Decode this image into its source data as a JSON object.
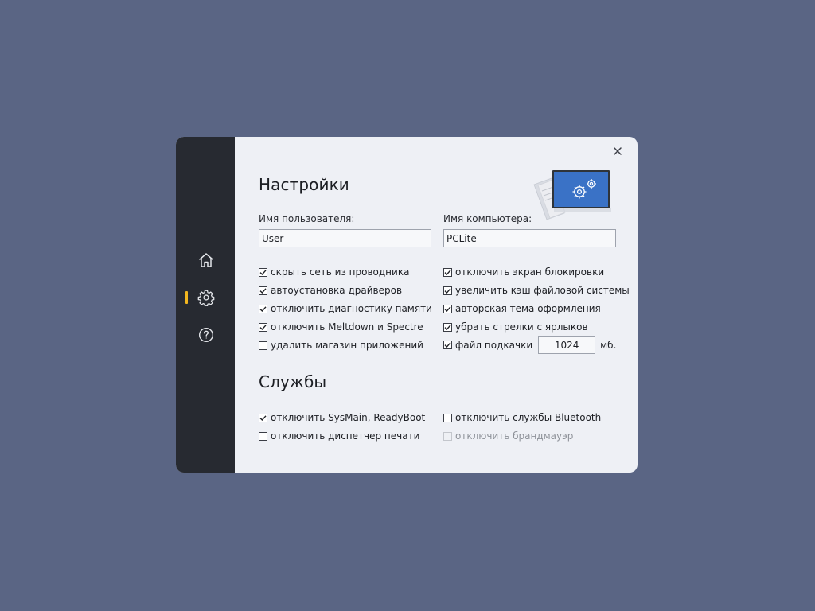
{
  "sidebar": {
    "items": [
      {
        "name": "home",
        "icon": "home-icon"
      },
      {
        "name": "settings",
        "icon": "gear-icon",
        "active": true
      },
      {
        "name": "help",
        "icon": "question-icon"
      }
    ],
    "active_color": "#f2b61f"
  },
  "window": {
    "close_icon": "close-icon"
  },
  "settings": {
    "title": "Настройки",
    "username_label": "Имя пользователя:",
    "username_value": "User",
    "computer_label": "Имя компьютера:",
    "computer_value": "PCLite",
    "options": [
      {
        "label": "скрыть сеть из проводника",
        "checked": true
      },
      {
        "label": "отключить экран блокировки",
        "checked": true
      },
      {
        "label": "автоустановка драйверов",
        "checked": true
      },
      {
        "label": "увеличить кэш файловой системы",
        "checked": true
      },
      {
        "label": "отключить диагностику памяти",
        "checked": true
      },
      {
        "label": "авторская тема оформления",
        "checked": true
      },
      {
        "label": "отключить Meltdown и Spectre",
        "checked": true
      },
      {
        "label": "убрать стрелки с ярлыков",
        "checked": true
      },
      {
        "label": "удалить магазин приложений",
        "checked": false
      },
      {
        "label": "файл подкачки",
        "checked": true
      }
    ],
    "swap_value": "1024",
    "swap_unit": "мб."
  },
  "services": {
    "title": "Службы",
    "options": [
      {
        "label": "отключить SysMain, ReadyBoot",
        "checked": true
      },
      {
        "label": "отключить службы Bluetooth",
        "checked": false
      },
      {
        "label": "отключить диспетчер печати",
        "checked": false
      },
      {
        "label": "отключить брандмауэр",
        "checked": false,
        "disabled": true
      }
    ]
  }
}
